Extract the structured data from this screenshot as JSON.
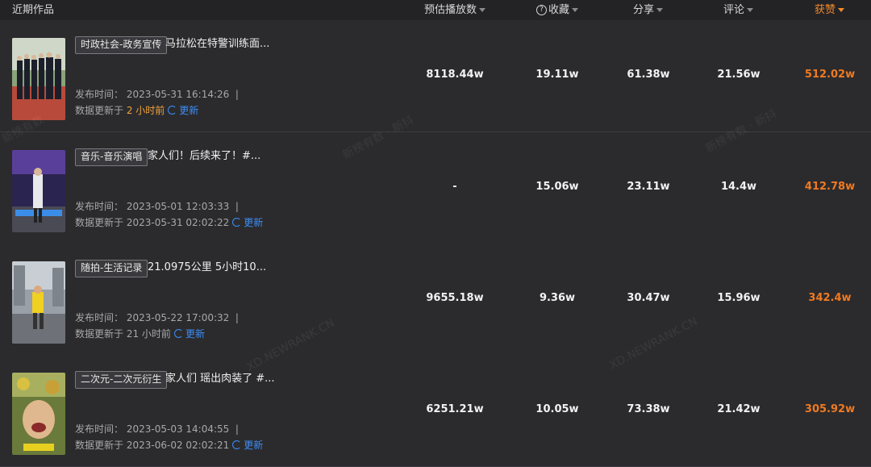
{
  "header": {
    "recent": "近期作品",
    "play": "预估播放数",
    "fav": "收藏",
    "share": "分享",
    "comment": "评论",
    "like": "获赞"
  },
  "colors": {
    "accent": "#f07a20",
    "refresh": "#3c8ef5",
    "highlight": "#f0a33c"
  },
  "rows": [
    {
      "tag": "时政社会-政务宣传",
      "title": "马拉松在特警训练面...",
      "pub_label": "发布时间：",
      "pub_time": "2023-05-31 16:14:26",
      "upd_label": "数据更新于",
      "upd_time": "2 小时前",
      "refresh": "更新",
      "play": "8118.44w",
      "fav": "19.11w",
      "share": "61.38w",
      "comment": "21.56w",
      "like": "512.02w"
    },
    {
      "tag": "音乐-音乐演唱",
      "title": "家人们！后续来了！#...",
      "pub_label": "发布时间：",
      "pub_time": "2023-05-01 12:03:33",
      "upd_label": "数据更新于",
      "upd_time": "2023-05-31 02:02:22",
      "refresh": "更新",
      "play": "-",
      "fav": "15.06w",
      "share": "23.11w",
      "comment": "14.4w",
      "like": "412.78w"
    },
    {
      "tag": "随拍-生活记录",
      "title": "21.0975公里 5小时10...",
      "pub_label": "发布时间：",
      "pub_time": "2023-05-22 17:00:32",
      "upd_label": "数据更新于",
      "upd_time": "21 小时前",
      "refresh": "更新",
      "play": "9655.18w",
      "fav": "9.36w",
      "share": "30.47w",
      "comment": "15.96w",
      "like": "342.4w"
    },
    {
      "tag": "二次元-二次元衍生",
      "title": "家人们 瑶出肉装了 #...",
      "pub_label": "发布时间：",
      "pub_time": "2023-05-03 14:04:55",
      "upd_label": "数据更新于",
      "upd_time": "2023-06-02 02:02:21",
      "refresh": "更新",
      "play": "6251.21w",
      "fav": "10.05w",
      "share": "73.38w",
      "comment": "21.42w",
      "like": "305.92w"
    }
  ],
  "watermarks": [
    "新榜有数 · 新抖",
    "新榜有数 · 新抖",
    "XD.NEWRANK.CN",
    "XD.NEWRANK.CN",
    "新榜有数"
  ]
}
